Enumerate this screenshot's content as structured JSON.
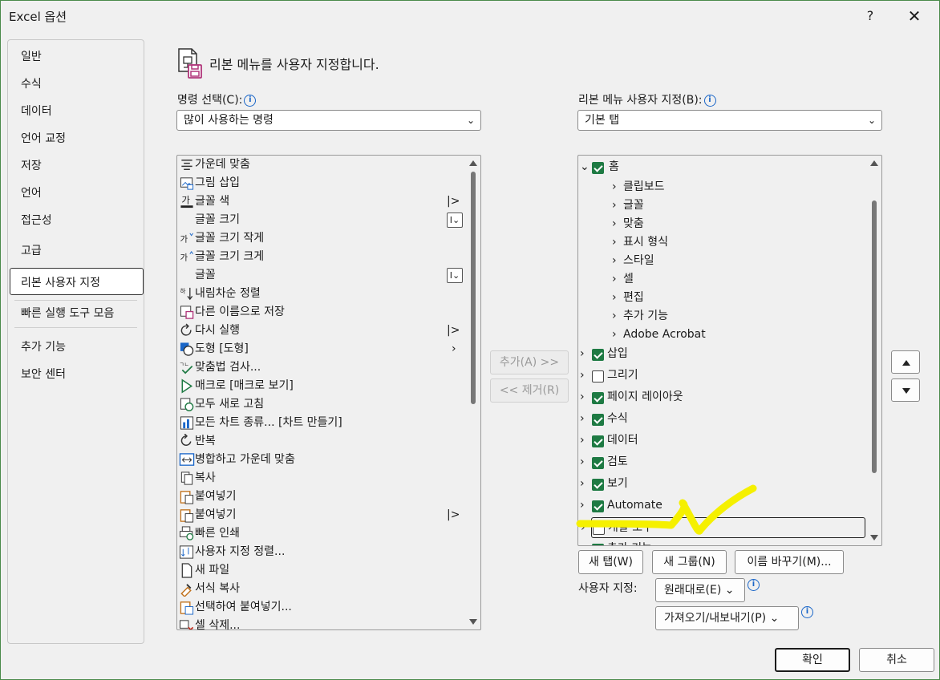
{
  "window": {
    "title": "Excel 옵션",
    "help": "?",
    "close": "✕"
  },
  "nav": {
    "items": [
      "일반",
      "수식",
      "데이터",
      "언어 교정",
      "저장",
      "언어",
      "접근성",
      "고급",
      "리본 사용자 지정",
      "빠른 실행 도구 모음",
      "추가 기능",
      "보안 센터"
    ],
    "selected": "리본 사용자 지정"
  },
  "header": {
    "text": "리본 메뉴를 사용자 지정합니다."
  },
  "left": {
    "label": "명령 선택(C):",
    "combo_value": "많이 사용하는 명령",
    "commands": [
      {
        "label": "가운데 맞춤",
        "icon": "align-center-icon",
        "extra": ""
      },
      {
        "label": "그림 삽입",
        "icon": "picture-icon",
        "extra": ""
      },
      {
        "label": "글꼴 색",
        "icon": "font-color-icon",
        "extra": "split"
      },
      {
        "label": "글꼴 크기",
        "icon": "",
        "extra": "field"
      },
      {
        "label": "글꼴 크기 작게",
        "icon": "font-decrease-icon",
        "extra": ""
      },
      {
        "label": "글꼴 크기 크게",
        "icon": "font-increase-icon",
        "extra": ""
      },
      {
        "label": "글꼴",
        "icon": "",
        "extra": "field"
      },
      {
        "label": "내림차순 정렬",
        "icon": "sort-desc-icon",
        "extra": ""
      },
      {
        "label": "다른 이름으로 저장",
        "icon": "save-as-icon",
        "extra": ""
      },
      {
        "label": "다시 실행",
        "icon": "redo-icon",
        "extra": "split"
      },
      {
        "label": "도형 [도형]",
        "icon": "shapes-icon",
        "extra": "menu"
      },
      {
        "label": "맞춤법 검사...",
        "icon": "spelling-icon",
        "extra": ""
      },
      {
        "label": "매크로 [매크로 보기]",
        "icon": "macro-icon",
        "extra": ""
      },
      {
        "label": "모두 새로 고침",
        "icon": "refresh-all-icon",
        "extra": ""
      },
      {
        "label": "모든 차트 종류... [차트 만들기]",
        "icon": "chart-icon",
        "extra": ""
      },
      {
        "label": "반복",
        "icon": "repeat-icon",
        "extra": ""
      },
      {
        "label": "병합하고 가운데 맞춤",
        "icon": "merge-center-icon",
        "extra": ""
      },
      {
        "label": "복사",
        "icon": "copy-icon",
        "extra": ""
      },
      {
        "label": "붙여넣기",
        "icon": "paste-icon",
        "extra": ""
      },
      {
        "label": "붙여넣기",
        "icon": "paste-icon",
        "extra": "split"
      },
      {
        "label": "빠른 인쇄",
        "icon": "quick-print-icon",
        "extra": ""
      },
      {
        "label": "사용자 지정 정렬...",
        "icon": "custom-sort-icon",
        "extra": ""
      },
      {
        "label": "새 파일",
        "icon": "new-file-icon",
        "extra": ""
      },
      {
        "label": "서식 복사",
        "icon": "format-painter-icon",
        "extra": ""
      },
      {
        "label": "선택하여 붙여넣기...",
        "icon": "paste-special-icon",
        "extra": ""
      },
      {
        "label": "셀 삭제...",
        "icon": "delete-cells-icon",
        "extra": ""
      }
    ]
  },
  "middle": {
    "add": "추가(A) >>",
    "remove": "<< 제거(R)"
  },
  "right": {
    "label": "리본 메뉴 사용자 지정(B):",
    "combo_value": "기본 탭",
    "home": {
      "label": "홈",
      "checked": true,
      "groups": [
        "클립보드",
        "글꼴",
        "맞춤",
        "표시 형식",
        "스타일",
        "셀",
        "편집",
        "추가 기능",
        "Adobe Acrobat"
      ]
    },
    "tabs": [
      {
        "label": "삽입",
        "checked": true
      },
      {
        "label": "그리기",
        "checked": false
      },
      {
        "label": "페이지 레이아웃",
        "checked": true
      },
      {
        "label": "수식",
        "checked": true
      },
      {
        "label": "데이터",
        "checked": true
      },
      {
        "label": "검토",
        "checked": true
      },
      {
        "label": "보기",
        "checked": true
      },
      {
        "label": "Automate",
        "checked": true
      },
      {
        "label": "개발 도구",
        "checked": false
      },
      {
        "label": "추가 기능",
        "checked": true
      }
    ],
    "focused_tab": "개발 도구",
    "annotation_color": "#f5f000"
  },
  "bottom": {
    "new_tab": "새 탭(W)",
    "new_group": "새 그룹(N)",
    "rename": "이름 바꾸기(M)...",
    "custom_label": "사용자 지정:",
    "reset": "원래대로(E)",
    "import_export": "가져오기/내보내기(P)"
  },
  "footer": {
    "ok": "확인",
    "cancel": "취소"
  }
}
